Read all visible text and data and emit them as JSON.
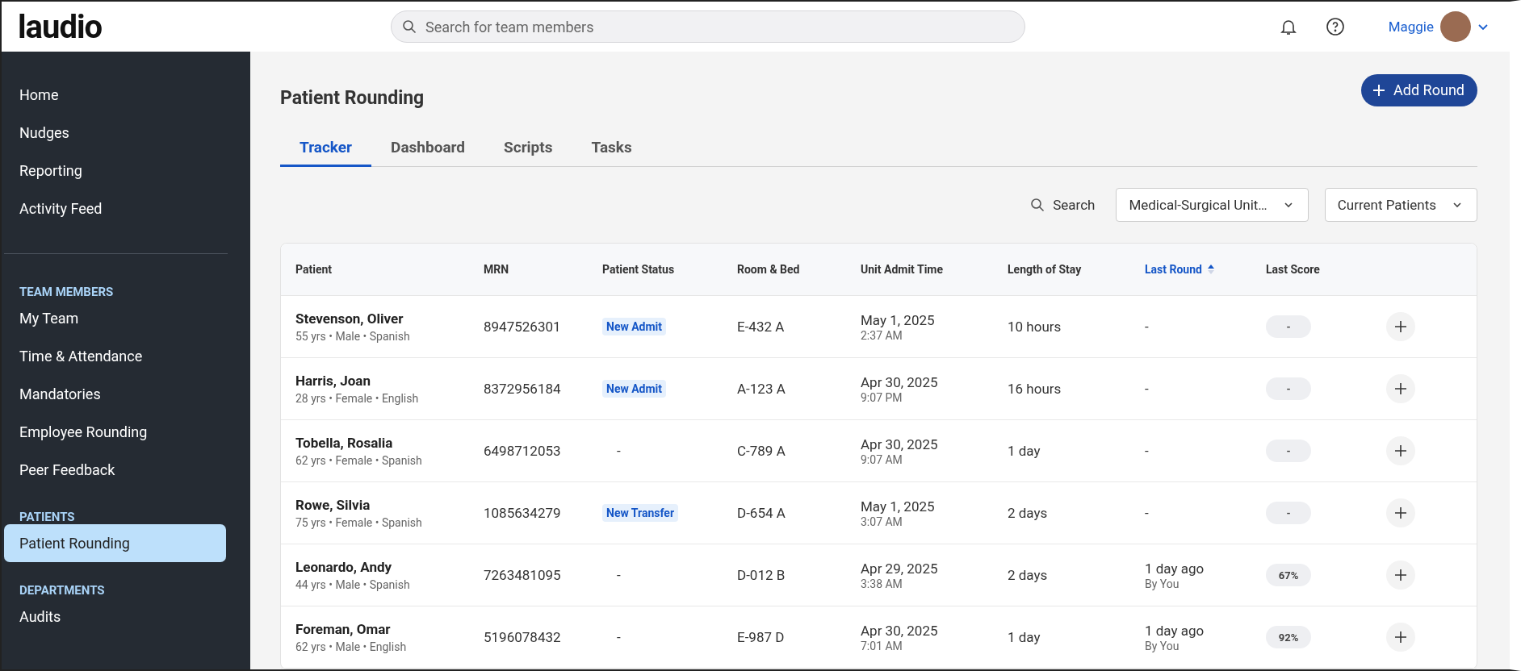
{
  "header": {
    "logo": "laudio",
    "search": {
      "placeholder": "Search for team members"
    },
    "user": {
      "name": "Maggie"
    }
  },
  "sidebar": {
    "groups": [
      {
        "items": [
          {
            "label": "Home",
            "selected": false
          },
          {
            "label": "Nudges",
            "selected": false
          },
          {
            "label": "Reporting",
            "selected": false
          },
          {
            "label": "Activity Feed",
            "selected": false
          }
        ]
      },
      {
        "heading": "TEAM MEMBERS",
        "items": [
          {
            "label": "My Team",
            "selected": false
          },
          {
            "label": "Time & Attendance",
            "selected": false
          },
          {
            "label": "Mandatories",
            "selected": false
          },
          {
            "label": "Employee Rounding",
            "selected": false
          },
          {
            "label": "Peer Feedback",
            "selected": false
          }
        ]
      },
      {
        "heading": "PATIENTS",
        "items": [
          {
            "label": "Patient Rounding",
            "selected": true
          }
        ]
      },
      {
        "heading": "DEPARTMENTS",
        "items": [
          {
            "label": "Audits",
            "selected": false
          }
        ]
      }
    ]
  },
  "page": {
    "title": "Patient Rounding",
    "add_button": "Add Round",
    "tabs": [
      {
        "label": "Tracker",
        "selected": true
      },
      {
        "label": "Dashboard",
        "selected": false
      },
      {
        "label": "Scripts",
        "selected": false
      },
      {
        "label": "Tasks",
        "selected": false
      }
    ],
    "filters": {
      "search_label": "Search",
      "unit": "Medical-Surgical Unit…",
      "patients": "Current Patients"
    }
  },
  "table": {
    "columns": [
      {
        "label": "Patient",
        "sorted": false
      },
      {
        "label": "MRN",
        "sorted": false
      },
      {
        "label": "Patient Status",
        "sorted": false
      },
      {
        "label": "Room & Bed",
        "sorted": false
      },
      {
        "label": "Unit Admit Time",
        "sorted": false
      },
      {
        "label": "Length of Stay",
        "sorted": false
      },
      {
        "label": "Last Round",
        "sorted": true
      },
      {
        "label": "Last Score",
        "sorted": false
      }
    ],
    "rows": [
      {
        "name": "Stevenson, Oliver",
        "details": "55 yrs • Male • Spanish",
        "mrn": "8947526301",
        "status": "New Admit",
        "status_badge": true,
        "room": "E-432 A",
        "admit_date": "May 1, 2025",
        "admit_time": "2:37 AM",
        "stay": "10 hours",
        "last_round": "-",
        "score": "-"
      },
      {
        "name": "Harris, Joan",
        "details": "28 yrs • Female • English",
        "mrn": "8372956184",
        "status": "New Admit",
        "status_badge": true,
        "room": "A-123 A",
        "admit_date": "Apr 30, 2025",
        "admit_time": "9:07 PM",
        "stay": "16 hours",
        "last_round": "-",
        "score": "-"
      },
      {
        "name": "Tobella, Rosalia",
        "details": "62 yrs • Female • Spanish",
        "mrn": "6498712053",
        "status": "-",
        "status_badge": false,
        "room": "C-789 A",
        "admit_date": "Apr 30, 2025",
        "admit_time": "9:07 AM",
        "stay": "1 day",
        "last_round": "-",
        "score": "-"
      },
      {
        "name": "Rowe, Silvia",
        "details": "75 yrs • Female • Spanish",
        "mrn": "1085634279",
        "status": "New Transfer",
        "status_badge": true,
        "room": "D-654 A",
        "admit_date": "May 1, 2025",
        "admit_time": "3:07 AM",
        "stay": "2 days",
        "last_round": "-",
        "score": "-"
      },
      {
        "name": "Leonardo, Andy",
        "details": "44 yrs • Male • Spanish",
        "mrn": "7263481095",
        "status": "-",
        "status_badge": false,
        "room": "D-012 B",
        "admit_date": "Apr 29, 2025",
        "admit_time": "3:38 AM",
        "stay": "2 days",
        "last_round": "1 day ago",
        "round_by": "By You",
        "score": "67%"
      },
      {
        "name": "Foreman, Omar",
        "details": "62 yrs • Male • English",
        "mrn": "5196078432",
        "status": "-",
        "status_badge": false,
        "room": "E-987 D",
        "admit_date": "Apr 30, 2025",
        "admit_time": "7:01 AM",
        "stay": "1 day",
        "last_round": "1 day ago",
        "round_by": "By You",
        "score": "92%"
      }
    ]
  }
}
